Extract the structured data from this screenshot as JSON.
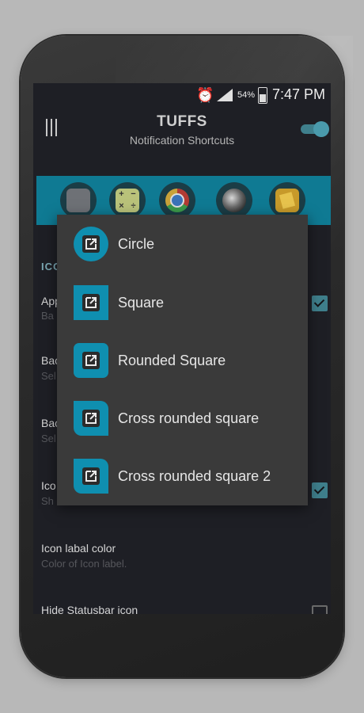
{
  "status_bar": {
    "alarm_icon": "alarm-clock-icon",
    "signal_icon": "cell-signal-icon",
    "battery_percent": "54%",
    "time": "7:47 PM"
  },
  "app_bar": {
    "menu_icon": "hamburger-menu-icon",
    "title": "TUFFS",
    "subtitle": "Notification Shortcuts",
    "toggle_on": true
  },
  "preview_icons": [
    "camera-icon",
    "calculator-icon",
    "chrome-icon",
    "photo-icon",
    "gallery-icon"
  ],
  "calculator_symbols": [
    "+",
    "−",
    "×",
    "÷"
  ],
  "settings": {
    "section_header": "ICO",
    "items": [
      {
        "title": "App",
        "summary": "Ba",
        "checked": true
      },
      {
        "title": "Bac",
        "summary": "Sel"
      },
      {
        "title": "Bac",
        "summary": "Sel"
      },
      {
        "title": "Ico",
        "summary": "Sh",
        "checked": true
      },
      {
        "title": "Icon labal color",
        "summary": "Color of Icon label."
      },
      {
        "title": "Hide Statusbar icon",
        "summary": "",
        "checked": false
      }
    ]
  },
  "dialog": {
    "options": [
      {
        "label": "Circle",
        "shape": "circle",
        "icon": "open-in-new-icon"
      },
      {
        "label": "Square",
        "shape": "square",
        "icon": "open-in-new-icon"
      },
      {
        "label": "Rounded Square",
        "shape": "rounded",
        "icon": "open-in-new-icon"
      },
      {
        "label": "Cross rounded square",
        "shape": "cross",
        "icon": "open-in-new-icon"
      },
      {
        "label": "Cross rounded square 2",
        "shape": "cross",
        "icon": "open-in-new-icon"
      }
    ]
  },
  "colors": {
    "accent": "#0f8fb0",
    "preview_strip": "#0f7a93",
    "screen_bg": "#1e1f25",
    "dialog_bg": "#3a3a3a"
  }
}
